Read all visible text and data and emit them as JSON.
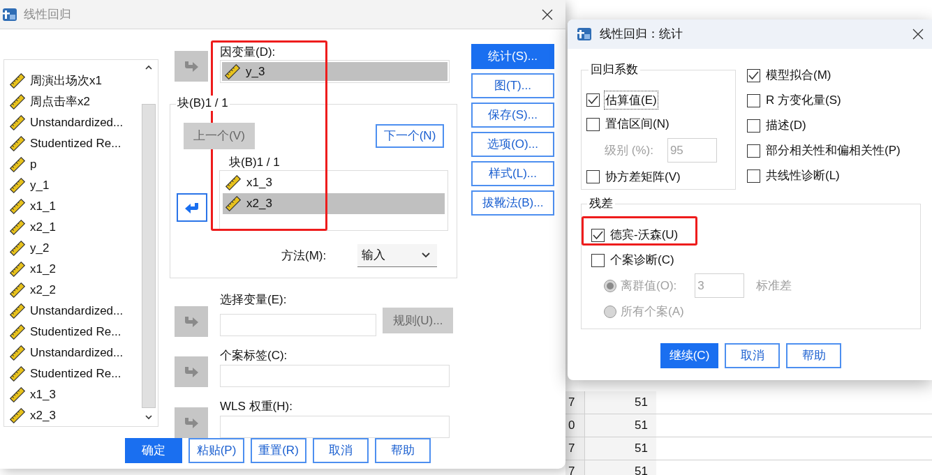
{
  "main_dialog": {
    "title": "线性回归",
    "active": false,
    "highlighted": true,
    "variables": [
      {
        "name": "周演出场次x1"
      },
      {
        "name": "周点击率x2"
      },
      {
        "name": "Unstandardized..."
      },
      {
        "name": "Studentized Re..."
      },
      {
        "name": "p"
      },
      {
        "name": "y_1"
      },
      {
        "name": "x1_1"
      },
      {
        "name": "x2_1"
      },
      {
        "name": "y_2"
      },
      {
        "name": "x1_2"
      },
      {
        "name": "x2_2"
      },
      {
        "name": "Unstandardized..."
      },
      {
        "name": "Studentized Re..."
      },
      {
        "name": "Unstandardized..."
      },
      {
        "name": "Studentized Re..."
      },
      {
        "name": "x1_3"
      },
      {
        "name": "x2_3"
      }
    ],
    "dependent": {
      "label": "因变量(D):",
      "arrow": {
        "kind": "right",
        "disabled": true
      },
      "items": [
        {
          "name": "y_3",
          "selected": true
        }
      ]
    },
    "block": {
      "legend": "块(B)1 / 1",
      "prev_button": {
        "label": "上一个(V)",
        "disabled": true
      },
      "next_button": {
        "label": "下一个(N)",
        "disabled": false
      },
      "list_label": "块(B)1 / 1",
      "arrow": {
        "kind": "left",
        "disabled": false
      },
      "items": [
        {
          "name": "x1_3",
          "selected": false
        },
        {
          "name": "x2_3",
          "selected": true
        }
      ],
      "method_label": "方法(M):",
      "method_value": "输入"
    },
    "selection": {
      "label": "选择变量(E):",
      "arrow": {
        "kind": "right",
        "disabled": true
      },
      "rule_button": {
        "label": "规则(U)...",
        "disabled": true
      }
    },
    "case_labels": {
      "label": "个案标签(C):",
      "arrow": {
        "kind": "right",
        "disabled": true
      }
    },
    "wls": {
      "label": "WLS 权重(H):",
      "arrow": {
        "kind": "right",
        "disabled": true
      }
    },
    "side_buttons": [
      {
        "label": "统计(S)...",
        "selected": true
      },
      {
        "label": "图(T)...",
        "selected": false
      },
      {
        "label": "保存(S)...",
        "selected": false
      },
      {
        "label": "选项(O)...",
        "selected": false
      },
      {
        "label": "样式(L)...",
        "selected": false
      },
      {
        "label": "拔靴法(B)...",
        "selected": false
      }
    ],
    "footer_buttons": [
      {
        "label": "确定",
        "primary": true
      },
      {
        "label": "粘贴(P)",
        "primary": false
      },
      {
        "label": "重置(R)",
        "primary": false
      },
      {
        "label": "取消",
        "primary": false
      },
      {
        "label": "帮助",
        "primary": false
      }
    ]
  },
  "stats_dialog": {
    "title": "线性回归：统计",
    "active": true,
    "coefficients": {
      "legend": "回归系数",
      "items": [
        {
          "kind": "checkbox",
          "label": "估算值(E)",
          "checked": true,
          "focused": true
        },
        {
          "kind": "checkbox",
          "label": "置信区间(N)",
          "checked": false,
          "focused": false
        },
        {
          "kind": "level",
          "label": "级别 (%):",
          "value": "95",
          "disabled": true
        },
        {
          "kind": "checkbox",
          "label": "协方差矩阵(V)",
          "checked": false,
          "focused": false
        }
      ]
    },
    "options": [
      {
        "label": "模型拟合(M)",
        "checked": true
      },
      {
        "label": "R 方变化量(S)",
        "checked": false
      },
      {
        "label": "描述(D)",
        "checked": false
      },
      {
        "label": "部分相关性和偏相关性(P)",
        "checked": false
      },
      {
        "label": "共线性诊断(L)",
        "checked": false
      }
    ],
    "residuals": {
      "legend": "残差",
      "durbin_watson": {
        "label": "德宾-沃森(U)",
        "checked": true,
        "highlighted": true
      },
      "casewise": {
        "label": "个案诊断(C)",
        "checked": false
      },
      "radios": [
        {
          "label": "离群值(O):",
          "selected": true,
          "disabled": true,
          "value": "3",
          "unit": "标准差"
        },
        {
          "label": "所有个案(A)",
          "selected": false,
          "disabled": true
        }
      ]
    },
    "buttons": [
      {
        "label": "继续(C)",
        "primary": true
      },
      {
        "label": "取消",
        "primary": false
      },
      {
        "label": "帮助",
        "primary": false
      }
    ]
  },
  "data_view": {
    "rows": [
      {
        "column_1": "7",
        "column_2": "51"
      },
      {
        "column_1": "0",
        "column_2": "51"
      },
      {
        "column_1": "7",
        "column_2": "51"
      },
      {
        "column_1": "7",
        "column_2": "51"
      }
    ]
  }
}
